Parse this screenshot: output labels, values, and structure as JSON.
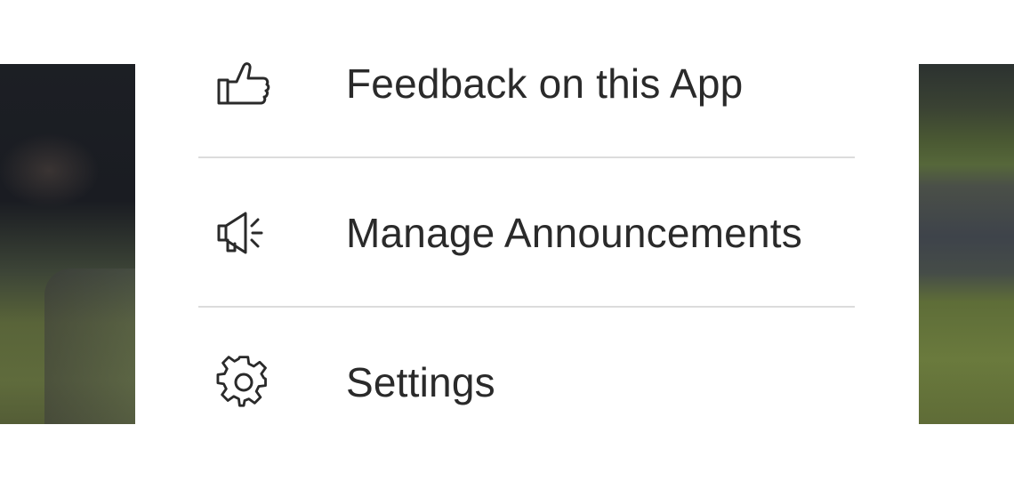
{
  "menu": {
    "items": [
      {
        "label": "Feedback on this App",
        "icon": "thumbs-up-icon"
      },
      {
        "label": "Manage Announcements",
        "icon": "megaphone-icon"
      },
      {
        "label": "Settings",
        "icon": "gear-icon"
      }
    ]
  },
  "colors": {
    "text": "#2a2a2a",
    "divider": "#dcdcdc",
    "menu_background": "#ffffff"
  }
}
